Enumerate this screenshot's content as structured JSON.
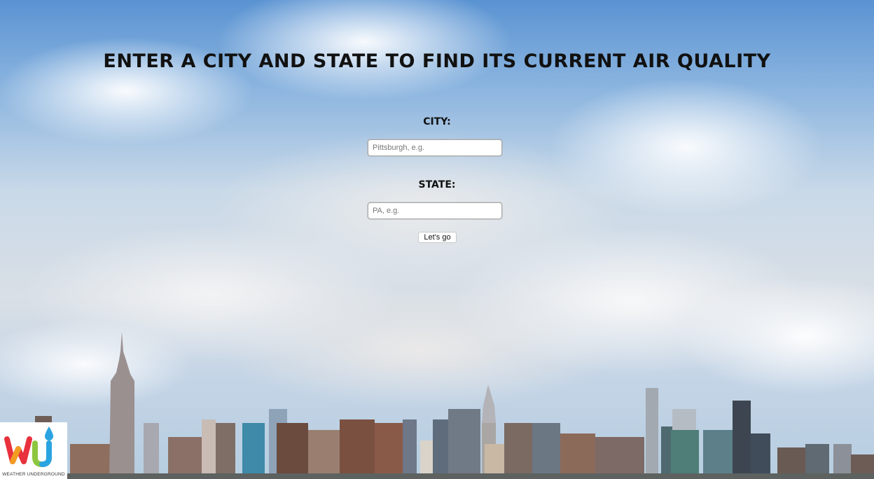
{
  "page": {
    "heading": "ENTER A CITY AND STATE TO FIND ITS CURRENT AIR QUALITY"
  },
  "form": {
    "city_label": "CITY:",
    "city_placeholder": "Pittsburgh, e.g.",
    "city_value": "",
    "state_label": "STATE:",
    "state_placeholder": "PA, e.g.",
    "state_value": "",
    "submit_label": "Let's go"
  },
  "logo": {
    "caption": "WEATHER UNDERGROUND",
    "icon": "weather-underground-logo",
    "colors": [
      "#e8313c",
      "#f39c22",
      "#2aa4e0",
      "#8dc63f"
    ]
  },
  "background": {
    "description_icon": "city-skyline-with-clouds",
    "colors": {
      "sky": "#5a93d2",
      "cloud": "#f2f2f2"
    }
  }
}
